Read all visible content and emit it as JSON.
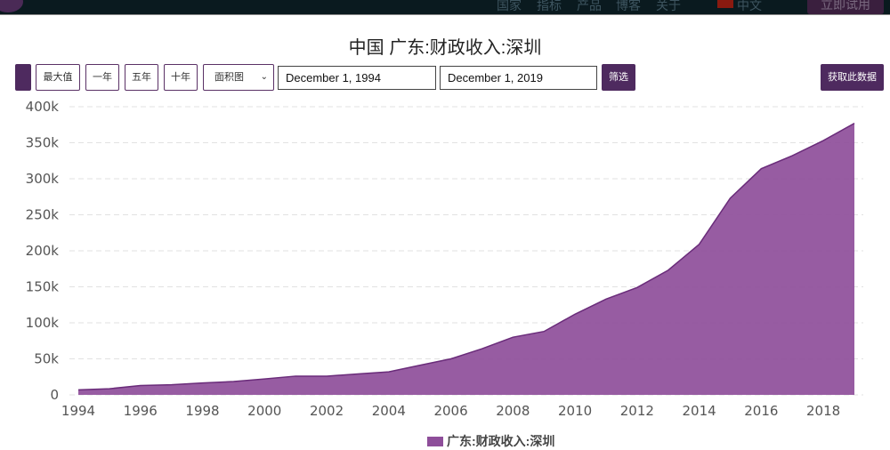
{
  "nav": {
    "items": [
      "国家",
      "指标",
      "产品",
      "博客",
      "关于"
    ],
    "language": "中文",
    "trial": "立即试用"
  },
  "toolbar": {
    "max": "最大值",
    "one_year": "一年",
    "five_year": "五年",
    "ten_year": "十年",
    "chart_type": "面积图",
    "start_date": "December 1, 1994",
    "end_date": "December 1, 2019",
    "filter": "筛选",
    "get_data": "获取此数据"
  },
  "colors": {
    "fill": "#8e4e9a",
    "line": "#6a2c7a",
    "accent": "#4e2a5f"
  },
  "chart_data": {
    "type": "area",
    "title": "中国 广东:财政收入:深圳",
    "legend": "广东:财政收入:深圳",
    "legend_position": "bottom-center",
    "x": [
      1994,
      1995,
      1996,
      1997,
      1998,
      1999,
      2000,
      2001,
      2002,
      2003,
      2004,
      2005,
      2006,
      2007,
      2008,
      2009,
      2010,
      2011,
      2012,
      2013,
      2014,
      2015,
      2016,
      2017,
      2018,
      2019
    ],
    "values": [
      7,
      8.5,
      13,
      14,
      16.5,
      18.5,
      22,
      26,
      26,
      29,
      32,
      41,
      50,
      64,
      80,
      88,
      112,
      133,
      149,
      173,
      209,
      273,
      314,
      332,
      353,
      377
    ],
    "unit": "k",
    "ylim": [
      0,
      400
    ],
    "yticks": [
      "0",
      "50k",
      "100k",
      "150k",
      "200k",
      "250k",
      "300k",
      "350k",
      "400k"
    ],
    "xticks": [
      "1994",
      "1996",
      "1998",
      "2000",
      "2002",
      "2004",
      "2006",
      "2008",
      "2010",
      "2012",
      "2014",
      "2016",
      "2018"
    ],
    "grid": true
  }
}
